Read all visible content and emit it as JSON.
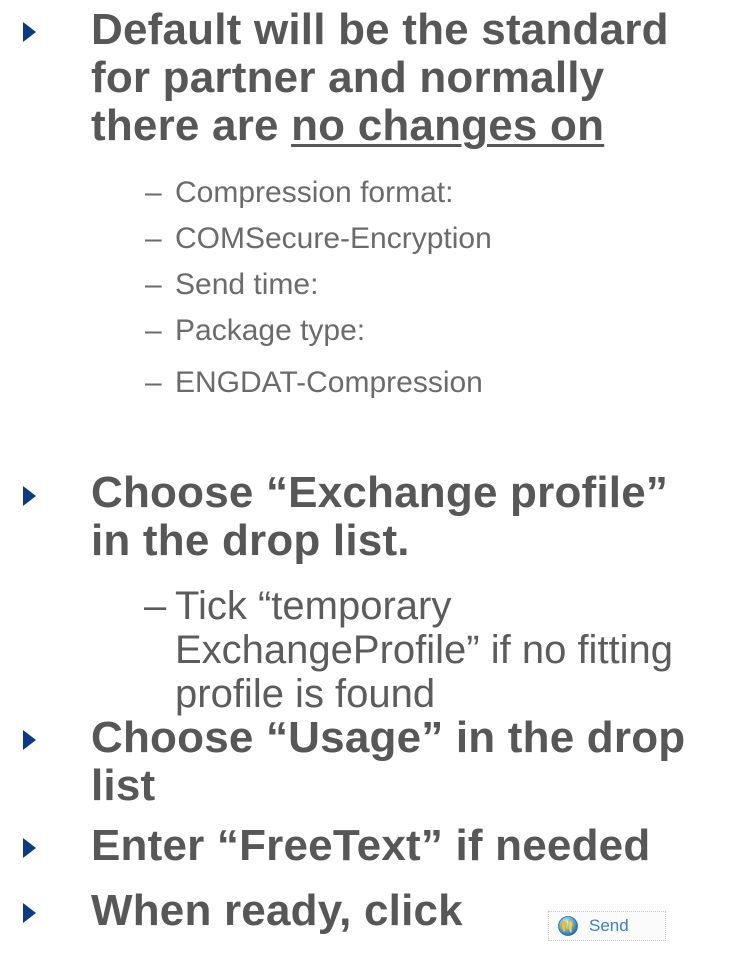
{
  "bullets": [
    {
      "lines": [
        "Default will be the standard",
        "for partner and normally"
      ],
      "line3_prefix": "there are ",
      "line3_underlined": "no changes on"
    },
    {
      "lines": [
        "Choose “Exchange profile”",
        "in the drop list."
      ]
    },
    {
      "lines": [
        "Choose “Usage” in the drop",
        "list"
      ]
    },
    {
      "lines": [
        "Enter “FreeText” if needed"
      ]
    },
    {
      "lines": [
        "When ready, click"
      ]
    }
  ],
  "sub_items_1": [
    "Compression format:",
    "COMSecure-Encryption",
    "Send time:",
    "Package type:",
    "ENGDAT-Compression"
  ],
  "dash": "–",
  "sub_item_2": {
    "lines": [
      "Tick “temporary",
      "ExchangeProfile” if no fitting",
      "profile is found"
    ]
  },
  "send_button": {
    "label": "Send",
    "icon": "globe-send-icon"
  },
  "colors": {
    "bullet_marker": "#0a3a86",
    "heading_text": "#575757",
    "sub_text": "#6b6b6b",
    "send_label": "#3b7fc4"
  }
}
